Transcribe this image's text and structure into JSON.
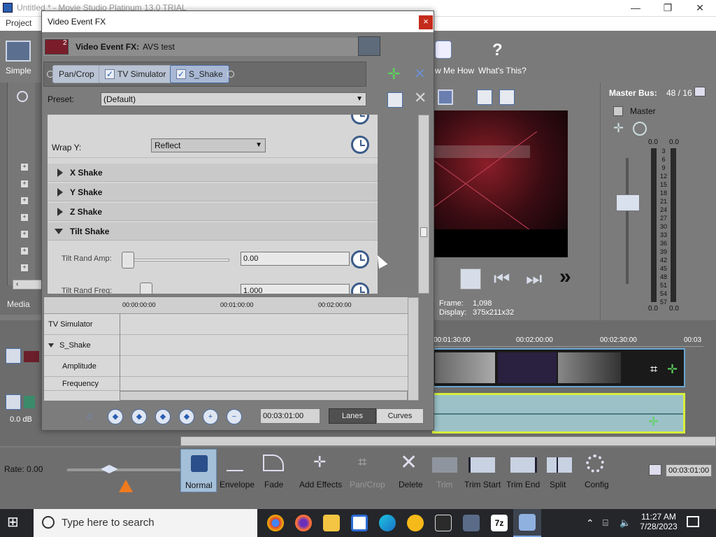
{
  "app": {
    "title": "Untitled * - Movie Studio Platinum 13.0 TRIAL",
    "menu_project": "Project"
  },
  "toolbar": {
    "simple": "Simple",
    "show_me_how": "w Me How",
    "whats_this": "What's This?"
  },
  "media": {
    "label": "Media"
  },
  "dialog": {
    "title": "Video Event FX",
    "close": "×",
    "fx_number": "2",
    "fx_label": "Video Event FX:",
    "fx_name": "AVS test",
    "chain": [
      "Pan/Crop",
      "TV Simulator",
      "S_Shake"
    ],
    "preset_label": "Preset:",
    "preset_value": "(Default)",
    "wrap_y_label": "Wrap Y:",
    "wrap_y_value": "Reflect",
    "sections": [
      "X Shake",
      "Y Shake",
      "Z Shake",
      "Tilt Shake"
    ],
    "tilt_rand_amp_label": "Tilt Rand Amp:",
    "tilt_rand_amp_value": "0.00",
    "tilt_rand_freq_label": "Tilt Rand Freq:",
    "tilt_rand_freq_value": "1.000",
    "ruler": [
      "00:00:00:00",
      "00:01:00:00",
      "00:02:00:00"
    ],
    "tracks": [
      "TV Simulator",
      "S_Shake",
      "Amplitude",
      "Frequency"
    ],
    "time_value": "00:03:01:00",
    "lanes": "Lanes",
    "curves": "Curves"
  },
  "preview": {
    "frame_label": "Frame:",
    "frame_value": "1,098",
    "display_label": "Display:",
    "display_value": "375x211x32"
  },
  "master": {
    "title": "Master Bus:",
    "value": "48 / 16",
    "name": "Master",
    "scale": [
      "0.0",
      "3",
      "6",
      "9",
      "12",
      "15",
      "18",
      "21",
      "24",
      "27",
      "30",
      "33",
      "36",
      "39",
      "42",
      "45",
      "48",
      "51",
      "54",
      "57"
    ],
    "left_peak": "0.0",
    "right_peak": "0.0",
    "bottom_left": "0.0",
    "bottom_right": "0.0"
  },
  "timeline": {
    "ruler": [
      "00:01:30:00",
      "00:02:00:00",
      "00:02:30:00",
      "00:03"
    ],
    "audio_level": "0.0 dB"
  },
  "bottom": {
    "rate": "Rate: 0.00",
    "tools": [
      "Normal",
      "Envelope",
      "Fade",
      "Add Effects",
      "Pan/Crop",
      "Delete",
      "Trim",
      "Trim Start",
      "Trim End",
      "Split",
      "Config"
    ],
    "time": "00:03:01:00"
  },
  "taskbar": {
    "search_placeholder": "Type here to search",
    "time": "11:27 AM",
    "date": "7/28/2023"
  }
}
